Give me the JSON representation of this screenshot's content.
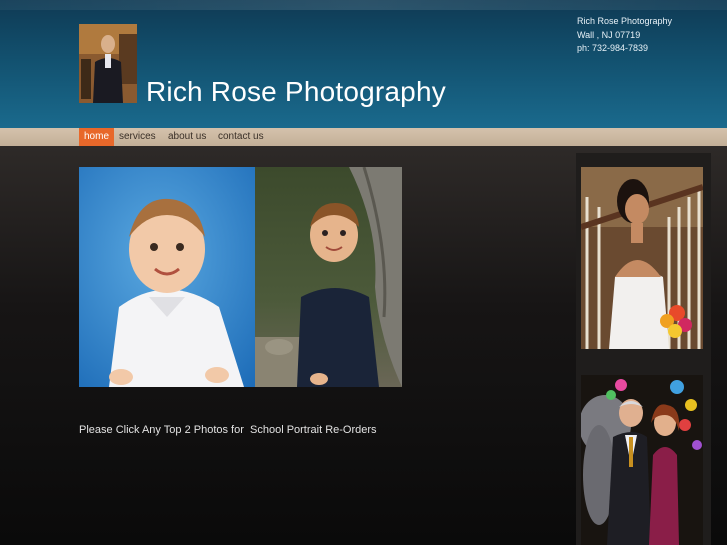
{
  "site": {
    "title": "Rich Rose Photography"
  },
  "contact": {
    "name": "Rich Rose Photography",
    "address": "Wall , NJ 07719",
    "phone": "ph: 732-984-7839"
  },
  "nav": {
    "items": [
      {
        "label": "home",
        "active": true
      },
      {
        "label": "services",
        "active": false
      },
      {
        "label": "about us",
        "active": false
      },
      {
        "label": "contact us",
        "active": false
      }
    ]
  },
  "main": {
    "caption": "Please Click Any Top 2 Photos for  School Portrait Re-Orders"
  },
  "colors": {
    "header_blue": "#12506e",
    "nav_tan": "#c9b59e",
    "nav_active": "#e8682a",
    "background": "#1a1817"
  }
}
